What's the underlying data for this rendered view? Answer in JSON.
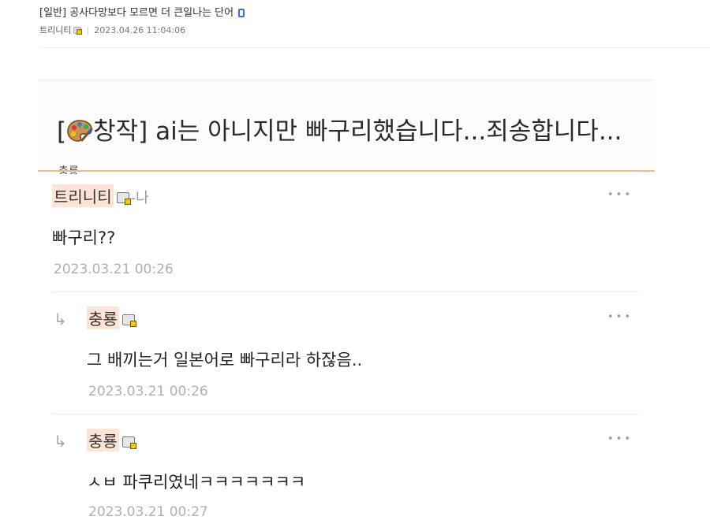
{
  "post": {
    "title": "[일반] 공사다망보다 모르면 더 큰일나는 단어",
    "author": "트리니티",
    "datetime": "2023.04.26 11:04:06"
  },
  "capture": {
    "title_bracket_open": "[",
    "title_text": "창작] ai는 아니지만 빠구리했습니다...죄송합니다...",
    "cut_author": "충룡",
    "cut_dots": "···"
  },
  "comments": [
    {
      "nick": "트리니티",
      "suffix": "-나",
      "text": "빠구리??",
      "date": "2023.03.21 00:26",
      "more": "•••"
    },
    {
      "reply_arrow": "↳",
      "nick": "충룡",
      "text": "그 배끼는거 일본어로 빠구리라 하잖음..",
      "date": "2023.03.21 00:26",
      "more": "•••"
    },
    {
      "reply_arrow": "↳",
      "nick": "충룡",
      "text": "ㅅㅂ 파쿠리였네ㅋㅋㅋㅋㅋㅋㅋ",
      "date": "2023.03.21 00:27",
      "more": "•••"
    }
  ],
  "colors": {
    "nick_highlight": "#fde4d6",
    "divider": "#e8bf90",
    "date": "#b0b0b0",
    "mobile_icon": "#3b6fd8"
  },
  "icons": {
    "mobile": "mobile-icon",
    "badge": "user-badge-icon",
    "palette": "palette-icon",
    "more": "more-dots-icon"
  }
}
